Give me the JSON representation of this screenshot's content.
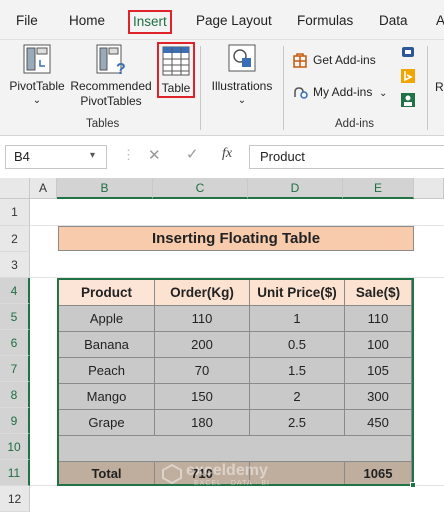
{
  "tabs": [
    {
      "label": "File"
    },
    {
      "label": "Home"
    },
    {
      "label": "Insert"
    },
    {
      "label": "Page Layout"
    },
    {
      "label": "Formulas"
    },
    {
      "label": "Data"
    },
    {
      "label": "A"
    }
  ],
  "ribbon": {
    "pivottable": "PivotTable",
    "recommended_1": "Recommended",
    "recommended_2": "PivotTables",
    "table": "Table",
    "illustrations": "Illustrations",
    "get_addins": "Get Add-ins",
    "my_addins": "My Add-ins",
    "group_tables": "Tables",
    "group_addins": "Add-ins",
    "cut_r": "R"
  },
  "formula_bar": {
    "name_box": "B4",
    "fx": "fx",
    "content": "Product"
  },
  "columns": [
    "A",
    "B",
    "C",
    "D",
    "E"
  ],
  "rows": [
    "1",
    "2",
    "3",
    "4",
    "5",
    "6",
    "7",
    "8",
    "9",
    "10",
    "11",
    "12"
  ],
  "sheet": {
    "title": "Inserting Floating Table",
    "headers": [
      "Product",
      "Order(Kg)",
      "Unit Price($)",
      "Sale($)"
    ],
    "data": [
      [
        "Apple",
        "110",
        "1",
        "110"
      ],
      [
        "Banana",
        "200",
        "0.5",
        "100"
      ],
      [
        "Peach",
        "70",
        "1.5",
        "105"
      ],
      [
        "Mango",
        "150",
        "2",
        "300"
      ],
      [
        "Grape",
        "180",
        "2.5",
        "450"
      ]
    ],
    "total": [
      "Total",
      "710",
      "",
      "1065"
    ]
  },
  "watermark": {
    "name": "exceldemy",
    "tagline": "EXCEL · DATA · BI"
  },
  "colors": {
    "accent": "#217346",
    "highlight": "#e0222a",
    "header_fill": "#fce4d6",
    "title_fill": "#f8cbad",
    "data_fill": "#c9c9c9",
    "total_fill": "#bfae9e"
  }
}
